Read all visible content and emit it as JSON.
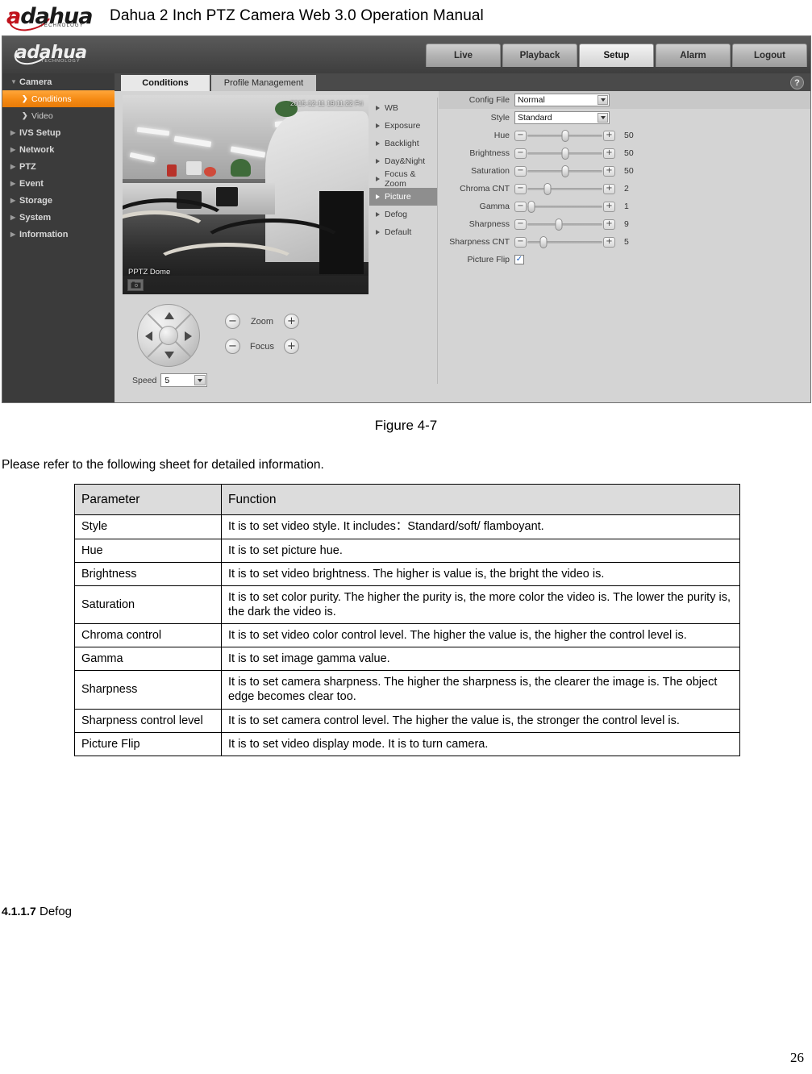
{
  "document": {
    "manual_title": "Dahua 2 Inch PTZ Camera Web 3.0 Operation Manual",
    "brand": "dahua",
    "brand_sub": "TECHNOLOGY",
    "figure_caption": "Figure 4-7",
    "intro_text": "Please refer to the following sheet for detailed information.",
    "section_number": "4.1.1.7",
    "section_title": "Defog",
    "page_number": "26"
  },
  "screenshot": {
    "brand": "dahua",
    "brand_sub": "TECHNOLOGY",
    "topnav": [
      {
        "label": "Live",
        "active": false
      },
      {
        "label": "Playback",
        "active": false
      },
      {
        "label": "Setup",
        "active": true
      },
      {
        "label": "Alarm",
        "active": false
      },
      {
        "label": "Logout",
        "active": false
      }
    ],
    "sidebar": [
      {
        "label": "Camera",
        "type": "group",
        "expanded": true
      },
      {
        "label": "Conditions",
        "type": "sub",
        "selected": true
      },
      {
        "label": "Video",
        "type": "sub",
        "selected": false
      },
      {
        "label": "IVS Setup",
        "type": "group",
        "expanded": false
      },
      {
        "label": "Network",
        "type": "group",
        "expanded": false
      },
      {
        "label": "PTZ",
        "type": "group",
        "expanded": false
      },
      {
        "label": "Event",
        "type": "group",
        "expanded": false
      },
      {
        "label": "Storage",
        "type": "group",
        "expanded": false
      },
      {
        "label": "System",
        "type": "group",
        "expanded": false
      },
      {
        "label": "Information",
        "type": "group",
        "expanded": false
      }
    ],
    "tabs": [
      {
        "label": "Conditions",
        "active": true
      },
      {
        "label": "Profile Management",
        "active": false
      }
    ],
    "help_icon": "?",
    "video": {
      "osd_time": "2015-12-11 19:11:22 Fri",
      "osd_channel": "PPTZ Dome",
      "snapshot_icon": "camera-icon"
    },
    "ptz": {
      "zoom_label": "Zoom",
      "focus_label": "Focus",
      "minus": "−",
      "plus": "+",
      "speed_label": "Speed",
      "speed_value": "5"
    },
    "conditions_menu": [
      {
        "label": "WB",
        "active": false
      },
      {
        "label": "Exposure",
        "active": false
      },
      {
        "label": "Backlight",
        "active": false
      },
      {
        "label": "Day&Night",
        "active": false
      },
      {
        "label": "Focus & Zoom",
        "active": false
      },
      {
        "label": "Picture",
        "active": true
      },
      {
        "label": "Defog",
        "active": false
      },
      {
        "label": "Default",
        "active": false
      }
    ],
    "form": {
      "config_file": {
        "label": "Config File",
        "value": "Normal"
      },
      "style": {
        "label": "Style",
        "value": "Standard"
      },
      "sliders": [
        {
          "label": "Hue",
          "value": "50",
          "percent": 50
        },
        {
          "label": "Brightness",
          "value": "50",
          "percent": 50
        },
        {
          "label": "Saturation",
          "value": "50",
          "percent": 50
        },
        {
          "label": "Chroma CNT",
          "value": "2",
          "percent": 27
        },
        {
          "label": "Gamma",
          "value": "1",
          "percent": 5
        },
        {
          "label": "Sharpness",
          "value": "9",
          "percent": 42
        },
        {
          "label": "Sharpness CNT",
          "value": "5",
          "percent": 22
        }
      ],
      "picture_flip": {
        "label": "Picture Flip",
        "checked": true,
        "mark": "✓"
      }
    }
  },
  "table": {
    "headers": [
      "Parameter",
      "Function"
    ],
    "rows": [
      {
        "parameter": "Style",
        "function": "It is to set video style. It includes：Standard/soft/ flamboyant."
      },
      {
        "parameter": "Hue",
        "function": "It is to set picture hue."
      },
      {
        "parameter": "Brightness",
        "function": "It is to set video brightness. The higher is value is, the bright the video is."
      },
      {
        "parameter": "Saturation",
        "function": "It is to set color purity. The higher the purity is, the more color the video is. The lower the purity is, the dark the video is."
      },
      {
        "parameter": "Chroma control",
        "function": "It is to set video color control level. The higher the value is, the higher the control level is."
      },
      {
        "parameter": "Gamma",
        "function": "It is to set image gamma value."
      },
      {
        "parameter": "Sharpness",
        "function": "It is to set camera sharpness. The higher the sharpness is, the clearer the image is. The object edge becomes clear too."
      },
      {
        "parameter": "Sharpness control level",
        "function": "It is to set camera control level. The higher the value is, the stronger the control level is."
      },
      {
        "parameter": "Picture Flip",
        "function": "It is to set video display mode. It is to turn camera."
      }
    ]
  },
  "colors": {
    "accent_orange": "#f68c16",
    "brand_red": "#c0121c",
    "panel_gray": "#d4d4d4",
    "sidebar_dark": "#3b3b3b"
  }
}
